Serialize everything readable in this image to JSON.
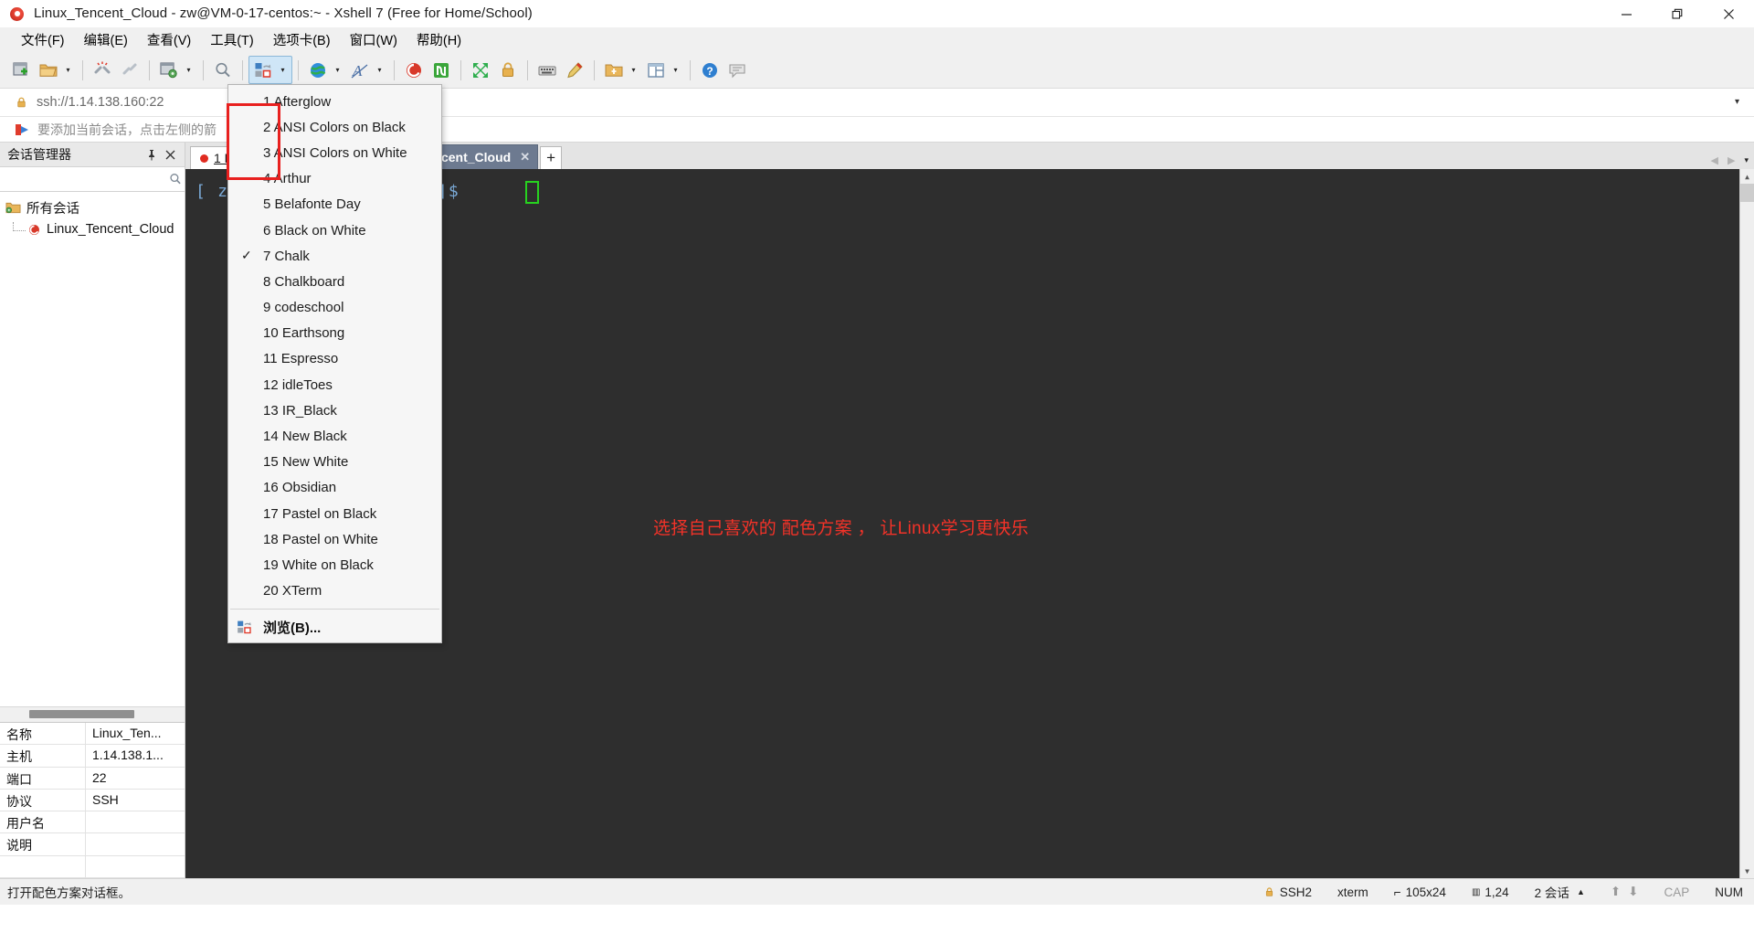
{
  "window": {
    "title": "Linux_Tencent_Cloud - zw@VM-0-17-centos:~ - Xshell 7 (Free for Home/School)",
    "app_icon": "xshell-swirl-icon",
    "minimize": "—",
    "maximize": "❐",
    "close": "✕"
  },
  "menubar": {
    "items": [
      {
        "label": "文件(F)"
      },
      {
        "label": "编辑(E)"
      },
      {
        "label": "查看(V)"
      },
      {
        "label": "工具(T)"
      },
      {
        "label": "选项卡(B)"
      },
      {
        "label": "窗口(W)"
      },
      {
        "label": "帮助(H)"
      }
    ]
  },
  "toolbar": {
    "caret": "▾",
    "items": [
      {
        "name": "new-session-icon"
      },
      {
        "name": "open-folder-icon"
      },
      {
        "name": "disconnect-icon"
      },
      {
        "name": "reconnect-icon"
      },
      {
        "name": "session-properties-icon"
      },
      {
        "name": "find-icon"
      },
      {
        "name": "color-scheme-icon"
      },
      {
        "name": "encoding-globe-icon"
      },
      {
        "name": "font-icon"
      },
      {
        "name": "xshell-swirl-icon"
      },
      {
        "name": "xftp-icon"
      },
      {
        "name": "fullscreen-icon"
      },
      {
        "name": "lock-icon"
      },
      {
        "name": "keyboard-icon"
      },
      {
        "name": "highlight-pen-icon"
      },
      {
        "name": "transfer-icon"
      },
      {
        "name": "layout-icon"
      },
      {
        "name": "help-icon"
      },
      {
        "name": "comment-icon"
      }
    ]
  },
  "address": {
    "lock_icon": "lock-icon",
    "value": "ssh://1.14.138.160:22",
    "caret": "▾"
  },
  "hint": {
    "icon": "red-arrow-icon",
    "text": "要添加当前会话，点击左侧的箭"
  },
  "sidebar": {
    "title": "会话管理器",
    "pin": "📌",
    "close": "✕",
    "search": {
      "value": "",
      "placeholder": "",
      "icon": "search-icon"
    },
    "tree": {
      "root": {
        "label": "所有会话",
        "icon": "folder-gear-icon"
      },
      "children": [
        {
          "label": "Linux_Tencent_Cloud",
          "icon": "xshell-swirl-icon"
        }
      ]
    },
    "properties": [
      {
        "key": "名称",
        "value": "Linux_Ten..."
      },
      {
        "key": "主机",
        "value": "1.14.138.1..."
      },
      {
        "key": "端口",
        "value": "22"
      },
      {
        "key": "协议",
        "value": "SSH"
      },
      {
        "key": "用户名",
        "value": ""
      },
      {
        "key": "说明",
        "value": ""
      },
      {
        "key": "",
        "value": ""
      }
    ]
  },
  "tabs": {
    "items": [
      {
        "label": "1 Linux_Tencent_Cloud",
        "active": false,
        "dot": true
      },
      {
        "label": "2 Linux_Tencent_Cloud",
        "active": true,
        "dot": false,
        "close": "✕"
      }
    ],
    "new_tab": "+",
    "nav_prev": "◀",
    "nav_next": "▶",
    "nav_menu": "▾"
  },
  "terminal": {
    "prompt": "[ zw@VM-0-17-centos  ~]$",
    "cursor": "block-cursor",
    "message": "选择自己喜欢的 配色方案 ， 让Linux学习更快乐",
    "message_color": "#f33228",
    "background_color": "#2e2e2e",
    "prompt_color": "#7aa9d6"
  },
  "color_scheme_menu": {
    "selected": "7 Chalk",
    "check_glyph": "✓",
    "items": [
      "1 Afterglow",
      "2 ANSI Colors on Black",
      "3 ANSI Colors on White",
      "4 Arthur",
      "5 Belafonte Day",
      "6 Black on White",
      "7 Chalk",
      "8 Chalkboard",
      "9 codeschool",
      "10 Earthsong",
      "11 Espresso",
      "12 idleToes",
      "13 IR_Black",
      "14 New Black",
      "15 New White",
      "16 Obsidian",
      "17 Pastel on Black",
      "18 Pastel on White",
      "19 White on Black",
      "20 XTerm"
    ],
    "browse": {
      "label": "浏览(B)...",
      "icon": "color-scheme-icon"
    }
  },
  "statusbar": {
    "message": "打开配色方案对话框。",
    "protocol": {
      "icon": "lock-icon",
      "label": "SSH2"
    },
    "terminal_type": "xterm",
    "size": {
      "icon": "size-icon",
      "label": "105x24"
    },
    "cursor_pos": {
      "icon": "pos-icon",
      "label": "1,24"
    },
    "sessions": {
      "label": "2 会话",
      "caret": "▲"
    },
    "transfer_up": "⬆",
    "transfer_down": "⬇",
    "cap": "CAP",
    "num": "NUM"
  },
  "colors": {
    "accent_red": "#e8201f",
    "tab_active_bg": "#6d7a90",
    "toolbar_active_bg": "#cfe6f7"
  }
}
